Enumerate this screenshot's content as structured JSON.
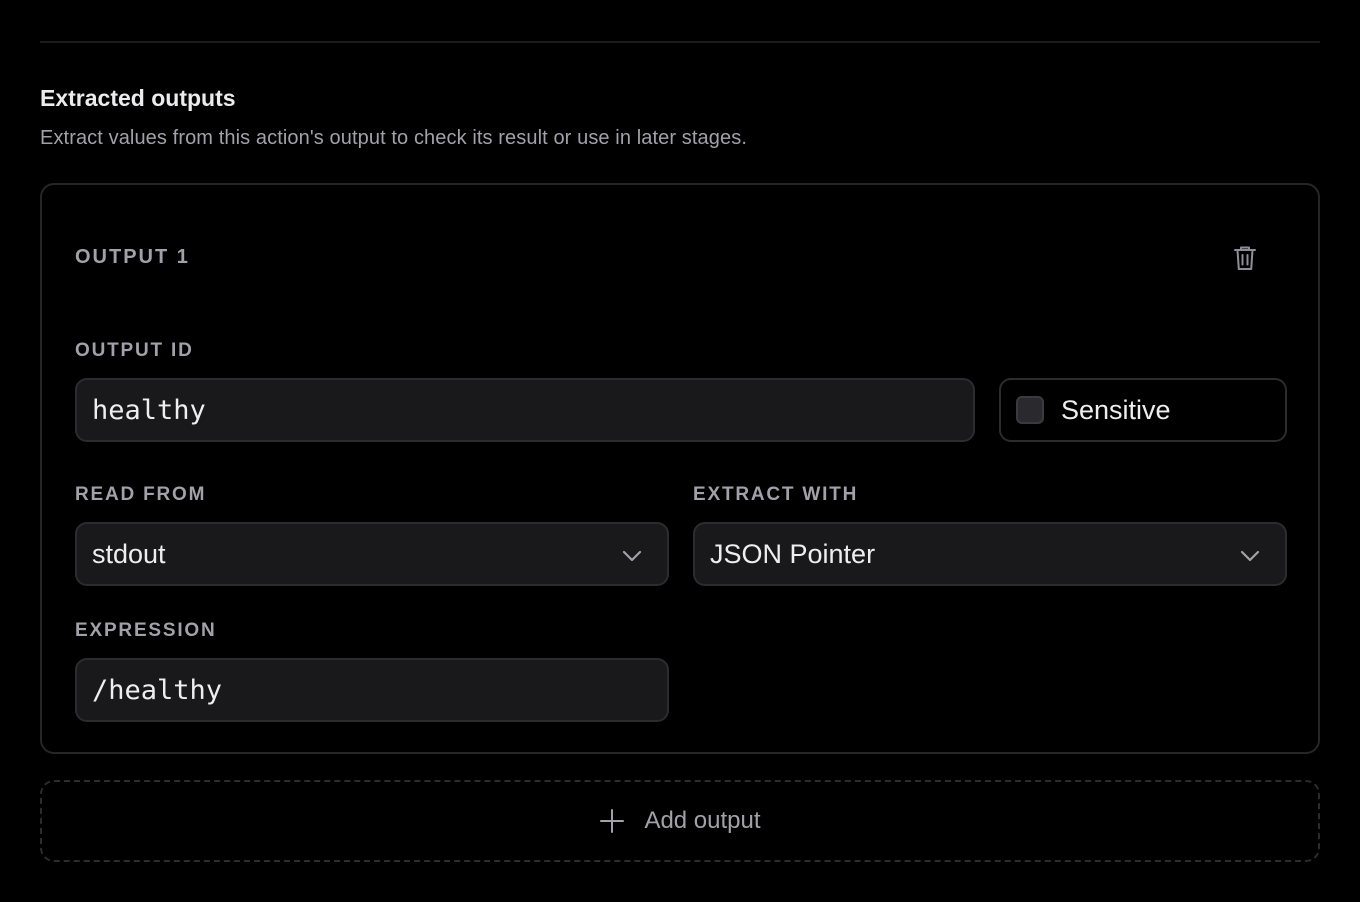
{
  "section": {
    "title": "Extracted outputs",
    "description": "Extract values from this action's output to check its result or use in later stages."
  },
  "output_card": {
    "title": "OUTPUT 1",
    "output_id": {
      "label": "OUTPUT ID",
      "value": "healthy"
    },
    "sensitive": {
      "label": "Sensitive",
      "checked": false
    },
    "read_from": {
      "label": "READ FROM",
      "selected": "stdout"
    },
    "extract_with": {
      "label": "EXTRACT WITH",
      "selected": "JSON Pointer"
    },
    "expression": {
      "label": "EXPRESSION",
      "value": "/healthy"
    }
  },
  "add_output": {
    "label": "Add output"
  },
  "icons": {
    "delete": "trash-icon",
    "dropdown": "chevron-down-icon",
    "add": "plus-icon"
  },
  "colors": {
    "background": "#000000",
    "field_background": "#19191b",
    "border": "#2c2c30",
    "muted_text": "#a1a1a9",
    "text": "#eeeef0"
  }
}
